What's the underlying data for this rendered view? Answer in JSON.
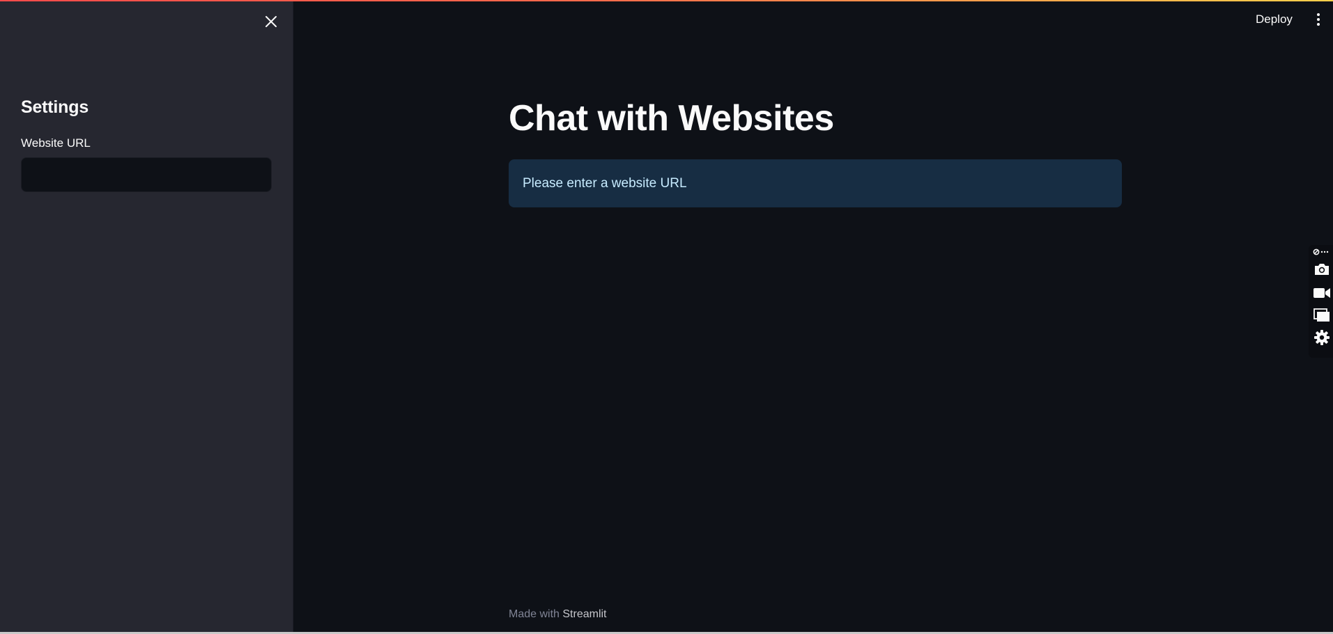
{
  "sidebar": {
    "title": "Settings",
    "url_field": {
      "label": "Website URL",
      "value": "",
      "placeholder": ""
    }
  },
  "header": {
    "deploy_label": "Deploy"
  },
  "main": {
    "title": "Chat with Websites",
    "info_message": "Please enter a website URL"
  },
  "footer": {
    "made_with": "Made with",
    "brand": "Streamlit"
  },
  "side_toolbar": {
    "tools": [
      "capture-more-icon",
      "camera-icon",
      "video-camera-icon",
      "windows-icon",
      "gear-icon"
    ]
  },
  "colors": {
    "background": "#0e1117",
    "sidebar": "#262730",
    "info_bg": "#172d43",
    "info_text": "#c7ebff",
    "accent": "#ff4b4b"
  }
}
